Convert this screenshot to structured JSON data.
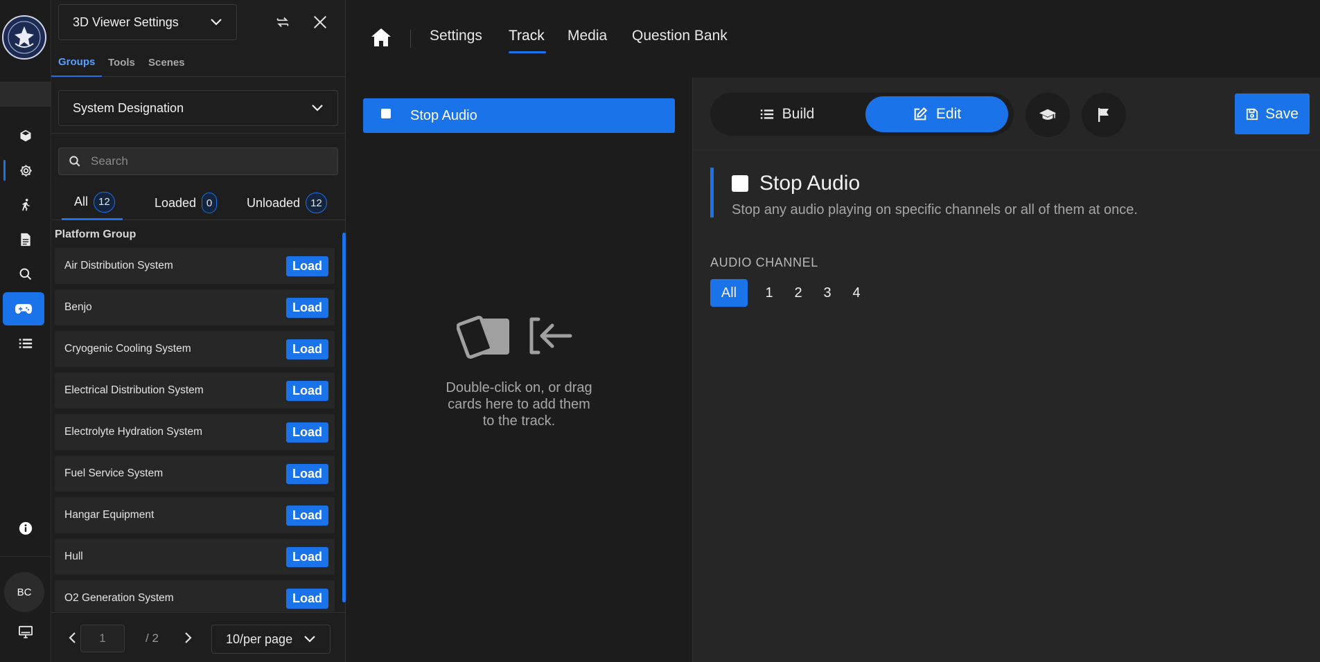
{
  "rail": {
    "avatar_initials": "BC",
    "icons": [
      "cube-icon",
      "gear-icon",
      "walking-icon",
      "document-icon",
      "search-icon",
      "gamepad-icon",
      "list-icon",
      "info-icon",
      "monitor-icon"
    ]
  },
  "panel": {
    "title": "3D Viewer Settings",
    "tabs": [
      "Groups",
      "Tools",
      "Scenes"
    ],
    "group_dropdown": "System Designation",
    "search_placeholder": "Search",
    "filters": [
      {
        "label": "All",
        "count": "12"
      },
      {
        "label": "Loaded",
        "count": "0"
      },
      {
        "label": "Unloaded",
        "count": "12"
      }
    ],
    "group_label": "Platform Group",
    "load_label": "Load",
    "items": [
      "Air Distribution System",
      "Benjo",
      "Cryogenic Cooling System",
      "Electrical Distribution System",
      "Electrolyte Hydration System",
      "Fuel Service System",
      "Hangar Equipment",
      "Hull",
      "O2 Generation System"
    ],
    "pager": {
      "page": "1",
      "total": "/ 2",
      "page_size": "10/per page"
    }
  },
  "topnav": {
    "items": [
      "Settings",
      "Track",
      "Media",
      "Question Bank"
    ],
    "active": "Track"
  },
  "track": {
    "card_label": "Stop Audio",
    "empty_hint_lines": [
      "Double-click on, or drag",
      "cards here to add them",
      "to the track."
    ]
  },
  "editor": {
    "build_label": "Build",
    "edit_label": "Edit",
    "save_label": "Save",
    "card_title": "Stop Audio",
    "card_desc": "Stop any audio playing on specific channels or all of them at once.",
    "section_label": "AUDIO CHANNEL",
    "channels": [
      "All",
      "1",
      "2",
      "3",
      "4"
    ],
    "selected_channel": "All"
  },
  "colors": {
    "accent": "#1a73e8",
    "background": "#1c1c1c",
    "panel": "#262626"
  }
}
